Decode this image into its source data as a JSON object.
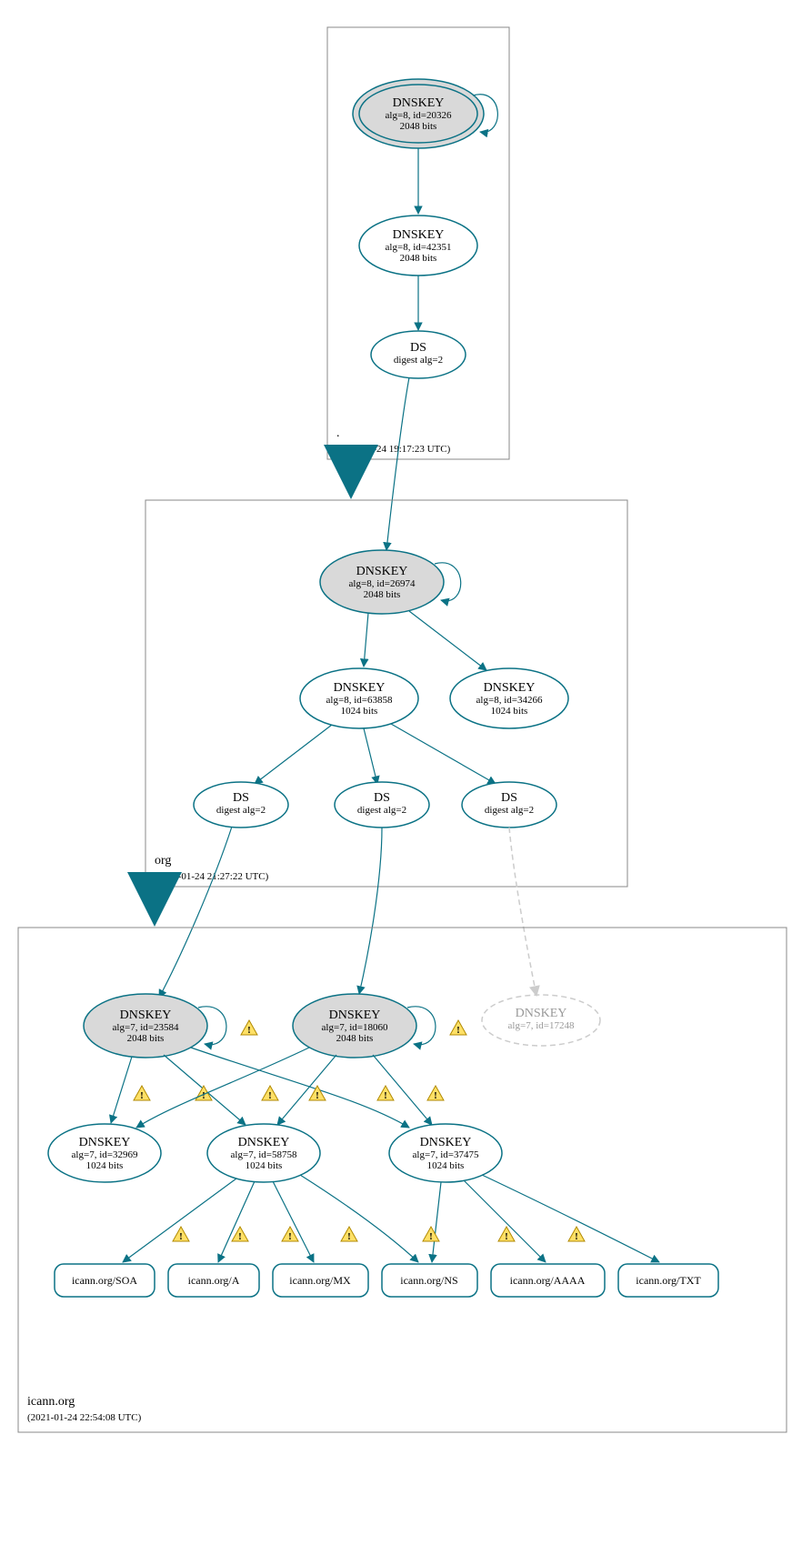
{
  "zones": {
    "root": {
      "name": ".",
      "timestamp": "(2021-01-24 19:17:23 UTC)"
    },
    "org": {
      "name": "org",
      "timestamp": "(2021-01-24 21:27:22 UTC)"
    },
    "icann": {
      "name": "icann.org",
      "timestamp": "(2021-01-24 22:54:08 UTC)"
    }
  },
  "nodes": {
    "root_ksk": {
      "t": "DNSKEY",
      "l2": "alg=8, id=20326",
      "l3": "2048 bits"
    },
    "root_zsk": {
      "t": "DNSKEY",
      "l2": "alg=8, id=42351",
      "l3": "2048 bits"
    },
    "root_ds": {
      "t": "DS",
      "l2": "digest alg=2"
    },
    "org_ksk": {
      "t": "DNSKEY",
      "l2": "alg=8, id=26974",
      "l3": "2048 bits"
    },
    "org_zsk": {
      "t": "DNSKEY",
      "l2": "alg=8, id=63858",
      "l3": "1024 bits"
    },
    "org_zsk2": {
      "t": "DNSKEY",
      "l2": "alg=8, id=34266",
      "l3": "1024 bits"
    },
    "org_ds1": {
      "t": "DS",
      "l2": "digest alg=2"
    },
    "org_ds2": {
      "t": "DS",
      "l2": "digest alg=2"
    },
    "org_ds3": {
      "t": "DS",
      "l2": "digest alg=2"
    },
    "ic_ksk1": {
      "t": "DNSKEY",
      "l2": "alg=7, id=23584",
      "l3": "2048 bits"
    },
    "ic_ksk2": {
      "t": "DNSKEY",
      "l2": "alg=7, id=18060",
      "l3": "2048 bits"
    },
    "ic_ksk3": {
      "t": "DNSKEY",
      "l2": "alg=7, id=17248"
    },
    "ic_zsk1": {
      "t": "DNSKEY",
      "l2": "alg=7, id=32969",
      "l3": "1024 bits"
    },
    "ic_zsk2": {
      "t": "DNSKEY",
      "l2": "alg=7, id=58758",
      "l3": "1024 bits"
    },
    "ic_zsk3": {
      "t": "DNSKEY",
      "l2": "alg=7, id=37475",
      "l3": "1024 bits"
    }
  },
  "records": {
    "soa": "icann.org/SOA",
    "a": "icann.org/A",
    "mx": "icann.org/MX",
    "ns": "icann.org/NS",
    "aaaa": "icann.org/AAAA",
    "txt": "icann.org/TXT"
  }
}
